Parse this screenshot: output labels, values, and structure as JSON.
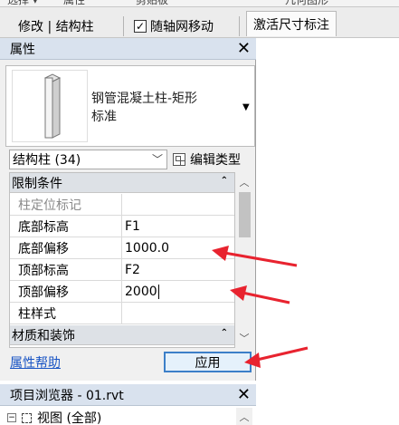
{
  "ribbon_cut": [
    "选择 ▾",
    "属性",
    "剪贴板",
    "几何图形"
  ],
  "context_bar": {
    "modify_label": "修改 | 结构柱",
    "checkbox_label": "随轴网移动",
    "checkbox_checked": true,
    "activate_tab": "激活尺寸标注"
  },
  "properties": {
    "title": "属性",
    "close": "✕",
    "type_name": "钢管混凝土柱-矩形\n标准",
    "instance_filter": "结构柱 (34)",
    "edit_type": "编辑类型",
    "groups": [
      {
        "label": "限制条件",
        "rows": [
          {
            "name": "柱定位标记",
            "value": "",
            "disabled": true
          },
          {
            "name": "底部标高",
            "value": "F1"
          },
          {
            "name": "底部偏移",
            "value": "1000.0"
          },
          {
            "name": "顶部标高",
            "value": "F2"
          },
          {
            "name": "顶部偏移",
            "value": "2000",
            "editing": true
          },
          {
            "name": "柱样式",
            "value": ""
          }
        ]
      },
      {
        "label": "材质和装饰",
        "rows": []
      }
    ],
    "help_link": "属性帮助",
    "apply_button": "应用"
  },
  "project_browser": {
    "title": "项目浏览器 - 01.rvt",
    "close": "✕",
    "tree_root": "视图 (全部)",
    "tree_toggle": "−"
  },
  "colors": {
    "annotation_arrow": "#e8232f",
    "panel_title_bg": "#d9e2ee",
    "link": "#1a55c4",
    "apply_border": "#3c7fc8"
  }
}
